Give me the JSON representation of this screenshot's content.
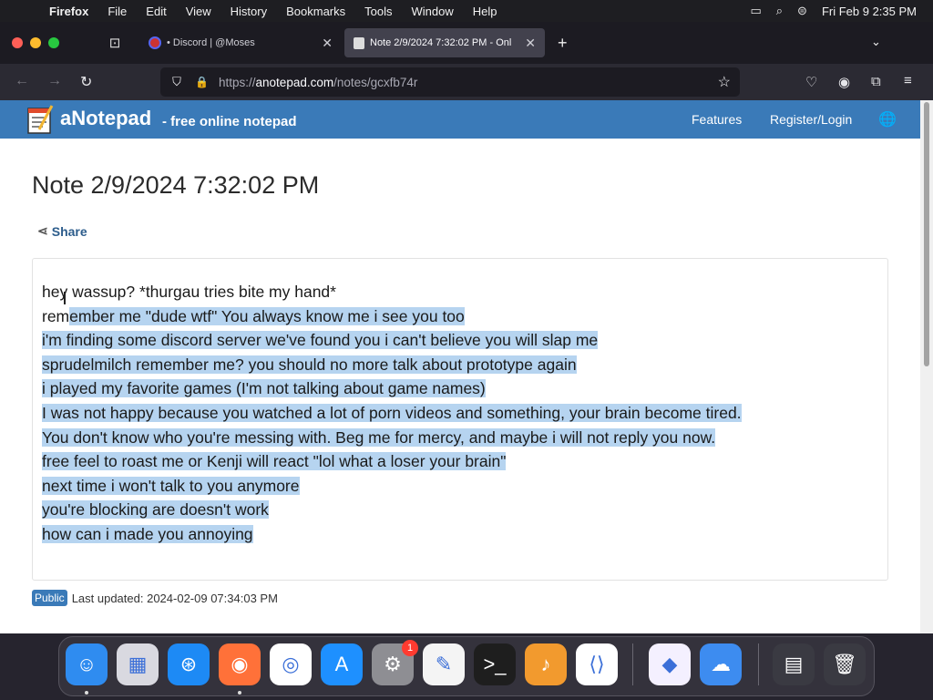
{
  "menubar": {
    "apple_icon": "apple-logo",
    "items": [
      "Firefox",
      "File",
      "Edit",
      "View",
      "History",
      "Bookmarks",
      "Tools",
      "Window",
      "Help"
    ],
    "datetime": "Fri Feb 9  2:35 PM"
  },
  "tabs": {
    "inactive_title": "• Discord | @Moses",
    "active_title": "Note 2/9/2024 7:32:02 PM - Onl"
  },
  "toolbar": {
    "url_scheme": "https://",
    "url_domain": "anotepad.com",
    "url_path": "/notes/gcxfb74r"
  },
  "site": {
    "brand": "aNotepad",
    "tagline": "- free online notepad",
    "nav_features": "Features",
    "nav_register": "Register/Login",
    "header_color": "#3a7ab8"
  },
  "note": {
    "title": "Note 2/9/2024 7:32:02 PM",
    "share_label": "Share",
    "lines": [
      {
        "pre": "hey wassup? *thurgau tries bite my hand*",
        "sel": ""
      },
      {
        "pre": "rem",
        "sel": "ember me \"dude wtf\" You always know me i see you too"
      },
      {
        "pre": "",
        "sel": "i'm finding some discord server we've found you i can't believe you will slap me"
      },
      {
        "pre": "",
        "sel": "sprudelmilch remember me? you should no more talk about prototype again"
      },
      {
        "pre": "",
        "sel": "i played my favorite games (I'm not talking about game names)"
      },
      {
        "pre": "",
        "sel": "I was not happy because you watched a lot of porn videos and something, your brain become tired."
      },
      {
        "pre": "",
        "sel": "You don't know who you're messing with. Beg me for mercy, and maybe i will not reply you now."
      },
      {
        "pre": "",
        "sel": "free feel to roast me or Kenji will react \"lol what a loser your brain\""
      },
      {
        "pre": "",
        "sel": "next time i won't talk to you anymore"
      },
      {
        "pre": "",
        "sel": "you're blocking are doesn't work"
      },
      {
        "pre": "",
        "sel": "how can i made you annoying"
      }
    ],
    "visibility_badge": "Public",
    "last_updated": "Last updated: 2024-02-09 07:34:03 PM",
    "selection_color": "#b6d4f0"
  },
  "dock": {
    "items": [
      "finder-icon",
      "launchpad-icon",
      "safari-icon",
      "firefox-icon",
      "chrome-icon",
      "app-store-icon",
      "system-settings-icon",
      "textedit-icon",
      "terminal-icon",
      "garageband-icon",
      "vscode-icon",
      "visual-studio-icon",
      "weather-icon",
      "downloads-icon",
      "trash-icon"
    ],
    "settings_badge": "1"
  }
}
